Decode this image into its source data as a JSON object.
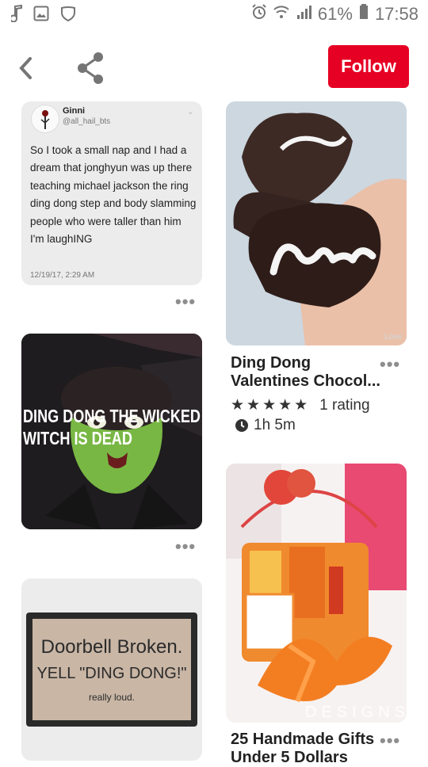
{
  "status_bar": {
    "battery": "61%",
    "time": "17:58"
  },
  "toolbar": {
    "follow_label": "Follow"
  },
  "left_column": {
    "tweet": {
      "name": "Ginni",
      "handle": "@all_hail_bts",
      "body": "So I took a small nap and I had a dream that jonghyun was up there teaching michael jackson the ring ding dong step and body slamming people who were taller than him I'm laughING",
      "date": "12/19/17, 2:29 AM"
    },
    "witch_caption_line1": "DING DONG THE WICKED",
    "witch_caption_line2": "WITCH IS DEAD",
    "doormat": {
      "line1": "Doorbell Broken.",
      "line2": "YELL \"DING DONG!\"",
      "line3": "really loud."
    }
  },
  "right_column": {
    "love_image_text": "Love",
    "pin1": {
      "title_line1": "Ding Dong",
      "title_line2": "Valentines Chocol...",
      "stars": "★★★★★",
      "rating_text": "1 rating",
      "time_text": "1h 5m",
      "rating_value": 5
    },
    "gifts_image_watermark": "DESIGNS",
    "pin2": {
      "title_line1": "25 Handmade Gifts",
      "title_line2": "Under 5 Dollars"
    }
  },
  "more_label": "•••",
  "colors": {
    "accent": "#e60023",
    "icon_gray": "#757575"
  }
}
